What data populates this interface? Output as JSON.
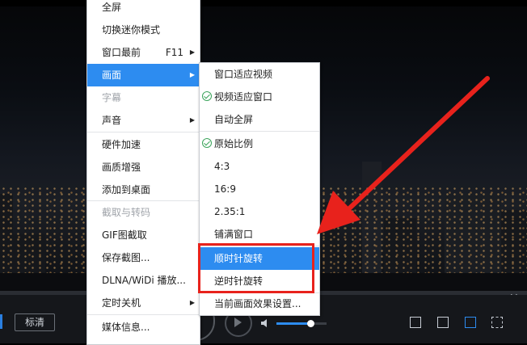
{
  "main_menu": {
    "items": [
      {
        "label": "全屏"
      },
      {
        "label": "切换迷你模式"
      },
      {
        "label": "窗口最前",
        "shortcut": "F11",
        "submenu": true
      },
      {
        "label": "画面",
        "submenu": true,
        "selected": true
      },
      {
        "label": "字幕",
        "disabled": true
      },
      {
        "label": "声音",
        "submenu": true
      },
      {
        "label": "硬件加速"
      },
      {
        "label": "画质增强"
      },
      {
        "label": "添加到桌面"
      },
      {
        "label": "截取与转码",
        "disabled": true
      },
      {
        "label": "GIF图截取"
      },
      {
        "label": "保存截图..."
      },
      {
        "label": "DLNA/WiDi 播放..."
      },
      {
        "label": "定时关机",
        "submenu": true
      },
      {
        "label": "媒体信息..."
      }
    ]
  },
  "submenu": {
    "items": [
      {
        "label": "窗口适应视频"
      },
      {
        "label": "视频适应窗口",
        "checked": true
      },
      {
        "label": "自动全屏"
      },
      {
        "label": "原始比例",
        "checked": true
      },
      {
        "label": "4:3"
      },
      {
        "label": "16:9"
      },
      {
        "label": "2.35:1"
      },
      {
        "label": "铺满窗口"
      },
      {
        "label": "顺时针旋转",
        "selected": true
      },
      {
        "label": "逆时针旋转"
      },
      {
        "label": "当前画面效果设置..."
      }
    ]
  },
  "controls": {
    "quality_label": "标清",
    "volume_level": 0.68
  },
  "colors": {
    "accent": "#2d8cf0",
    "highlight_box": "#e8221c",
    "arrow": "#e8221c"
  }
}
